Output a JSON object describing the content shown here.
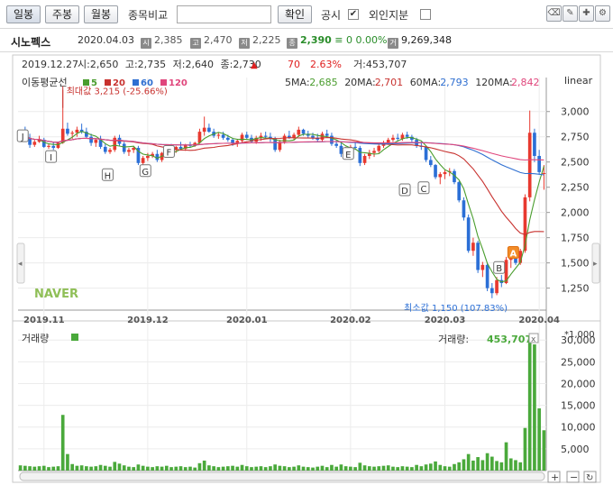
{
  "toolbar": {
    "daily": "일봉",
    "weekly": "주봉",
    "monthly": "월봉",
    "compare_label": "종목비교",
    "confirm": "확인",
    "disclosure_label": "공시",
    "foreign_label": "외인지분"
  },
  "header": {
    "name": "시노펙스",
    "date": "2020.04.03",
    "open": "2,385",
    "high": "2,470",
    "low": "2,225",
    "close": "2,390",
    "change_symbol": "≡",
    "change": "0",
    "change_pct": "0.00%",
    "volume": "9,269,348",
    "icons": [
      "시",
      "고",
      "저",
      "종",
      "거"
    ]
  },
  "chart_info": {
    "date": "2019.12.27",
    "open_label": "시:",
    "open": "2,650",
    "high_label": "고:",
    "high": "2,735",
    "low_label": "저:",
    "low": "2,640",
    "close_label": "종:",
    "close": "2,730",
    "change": "70",
    "change_pct": "2.63%",
    "vol_label": "거:",
    "volume": "453,707",
    "scale": "linear",
    "ma_title": "이동평균선",
    "ma_legend": [
      {
        "label": "5",
        "color": "#4a9d2e"
      },
      {
        "label": "20",
        "color": "#c8322f"
      },
      {
        "label": "60",
        "color": "#2f6fd1"
      },
      {
        "label": "120",
        "color": "#e0467c"
      }
    ],
    "ma_values": [
      {
        "label": "5MA:",
        "value": "2,685",
        "color": "#4a9d2e"
      },
      {
        "label": "20MA:",
        "value": "2,701",
        "color": "#c8322f"
      },
      {
        "label": "60MA:",
        "value": "2,793",
        "color": "#2f6fd1"
      },
      {
        "label": "120MA:",
        "value": "2,842",
        "color": "#e0467c"
      }
    ],
    "max_label": "최대값 3,215 (-25.66%)",
    "min_label": "최소값 1,150 (107.83%)",
    "watermark": "NAVER",
    "y_ticks": [
      3000,
      2750,
      2500,
      2250,
      2000,
      1750,
      1500,
      1250
    ],
    "y_tick_labels": [
      "3,000",
      "2,750",
      "2,500",
      "2,250",
      "2,000",
      "1,750",
      "1,500",
      "1,250"
    ],
    "x_labels": [
      "2019.11",
      "2019.12",
      "2020.01",
      "2020.02",
      "2020.03",
      "2020.04"
    ],
    "markers": [
      "J",
      "I",
      "H",
      "G",
      "F",
      "E",
      "D",
      "C",
      "B",
      "A"
    ],
    "vol_title": "거래량",
    "vol_value_label": "거래량:",
    "vol_value": "453,707",
    "vol_unit": "*1,000",
    "vol_ticks": [
      30000,
      25000,
      20000,
      15000,
      10000,
      5000
    ],
    "vol_tick_labels": [
      "30,000",
      "25,000",
      "20,000",
      "15,000",
      "10,000",
      "5,000"
    ]
  },
  "chart_data": {
    "type": "candlestick",
    "ylim": [
      1050,
      3230
    ],
    "volume_ylim": [
      0,
      31500
    ],
    "series": [
      {
        "name": "가격",
        "ohlc": [
          [
            2730,
            2810,
            2700,
            2790
          ],
          [
            2790,
            2850,
            2720,
            2740
          ],
          [
            2740,
            2780,
            2640,
            2670
          ],
          [
            2670,
            2720,
            2650,
            2700
          ],
          [
            2700,
            2760,
            2690,
            2720
          ],
          [
            2720,
            2740,
            2640,
            2650
          ],
          [
            2650,
            2680,
            2630,
            2660
          ],
          [
            2660,
            2700,
            2620,
            2640
          ],
          [
            2640,
            2700,
            2630,
            2690
          ],
          [
            2690,
            3215,
            2680,
            2830
          ],
          [
            2830,
            2890,
            2760,
            2780
          ],
          [
            2780,
            2810,
            2730,
            2790
          ],
          [
            2790,
            2850,
            2750,
            2820
          ],
          [
            2820,
            2880,
            2780,
            2800
          ],
          [
            2800,
            2840,
            2740,
            2750
          ],
          [
            2750,
            2780,
            2660,
            2690
          ],
          [
            2690,
            2730,
            2650,
            2720
          ],
          [
            2720,
            2760,
            2630,
            2650
          ],
          [
            2650,
            2680,
            2580,
            2600
          ],
          [
            2600,
            2640,
            2580,
            2620
          ],
          [
            2620,
            2760,
            2600,
            2740
          ],
          [
            2740,
            2770,
            2660,
            2680
          ],
          [
            2680,
            2700,
            2580,
            2600
          ],
          [
            2600,
            2640,
            2560,
            2620
          ],
          [
            2620,
            2660,
            2590,
            2640
          ],
          [
            2640,
            2660,
            2470,
            2490
          ],
          [
            2490,
            2560,
            2470,
            2540
          ],
          [
            2540,
            2590,
            2510,
            2560
          ],
          [
            2560,
            2600,
            2540,
            2580
          ],
          [
            2580,
            2620,
            2500,
            2520
          ],
          [
            2520,
            2600,
            2500,
            2590
          ],
          [
            2590,
            2660,
            2570,
            2640
          ],
          [
            2640,
            2680,
            2600,
            2620
          ],
          [
            2620,
            2660,
            2590,
            2650
          ],
          [
            2650,
            2700,
            2620,
            2630
          ],
          [
            2630,
            2680,
            2610,
            2670
          ],
          [
            2670,
            2700,
            2640,
            2660
          ],
          [
            2660,
            2700,
            2650,
            2690
          ],
          [
            2690,
            2830,
            2680,
            2800
          ],
          [
            2800,
            2950,
            2760,
            2840
          ],
          [
            2840,
            2880,
            2790,
            2800
          ],
          [
            2800,
            2830,
            2740,
            2760
          ],
          [
            2760,
            2790,
            2730,
            2770
          ],
          [
            2770,
            2800,
            2720,
            2740
          ],
          [
            2740,
            2770,
            2700,
            2720
          ],
          [
            2720,
            2740,
            2660,
            2680
          ],
          [
            2680,
            2730,
            2650,
            2710
          ],
          [
            2710,
            2790,
            2690,
            2770
          ],
          [
            2770,
            2800,
            2720,
            2740
          ],
          [
            2740,
            2770,
            2690,
            2700
          ],
          [
            2700,
            2760,
            2680,
            2740
          ],
          [
            2740,
            2790,
            2710,
            2760
          ],
          [
            2760,
            2800,
            2730,
            2750
          ],
          [
            2750,
            2790,
            2700,
            2730
          ],
          [
            2730,
            2750,
            2600,
            2620
          ],
          [
            2620,
            2720,
            2600,
            2700
          ],
          [
            2700,
            2780,
            2680,
            2760
          ],
          [
            2760,
            2810,
            2730,
            2740
          ],
          [
            2740,
            2790,
            2720,
            2770
          ],
          [
            2770,
            2850,
            2750,
            2820
          ],
          [
            2820,
            2830,
            2760,
            2780
          ],
          [
            2780,
            2810,
            2740,
            2760
          ],
          [
            2760,
            2790,
            2720,
            2740
          ],
          [
            2740,
            2780,
            2700,
            2720
          ],
          [
            2720,
            2800,
            2700,
            2780
          ],
          [
            2780,
            2820,
            2740,
            2760
          ],
          [
            2760,
            2790,
            2660,
            2680
          ],
          [
            2680,
            2720,
            2640,
            2660
          ],
          [
            2660,
            2700,
            2550,
            2580
          ],
          [
            2580,
            2650,
            2560,
            2620
          ],
          [
            2620,
            2670,
            2600,
            2650
          ],
          [
            2650,
            2700,
            2620,
            2640
          ],
          [
            2640,
            2660,
            2460,
            2490
          ],
          [
            2490,
            2580,
            2470,
            2560
          ],
          [
            2560,
            2620,
            2530,
            2590
          ],
          [
            2590,
            2640,
            2550,
            2610
          ],
          [
            2610,
            2680,
            2590,
            2660
          ],
          [
            2660,
            2710,
            2640,
            2690
          ],
          [
            2690,
            2740,
            2670,
            2720
          ],
          [
            2720,
            2770,
            2700,
            2740
          ],
          [
            2740,
            2780,
            2710,
            2730
          ],
          [
            2730,
            2790,
            2710,
            2770
          ],
          [
            2770,
            2800,
            2730,
            2750
          ],
          [
            2750,
            2770,
            2700,
            2720
          ],
          [
            2720,
            2740,
            2640,
            2660
          ],
          [
            2660,
            2700,
            2620,
            2650
          ],
          [
            2650,
            2660,
            2500,
            2520
          ],
          [
            2520,
            2560,
            2450,
            2470
          ],
          [
            2470,
            2480,
            2330,
            2350
          ],
          [
            2350,
            2400,
            2280,
            2380
          ],
          [
            2380,
            2420,
            2330,
            2400
          ],
          [
            2400,
            2440,
            2360,
            2410
          ],
          [
            2410,
            2430,
            2280,
            2300
          ],
          [
            2300,
            2310,
            2100,
            2120
          ],
          [
            2120,
            2150,
            1920,
            1950
          ],
          [
            1950,
            1980,
            1600,
            1620
          ],
          [
            1620,
            1750,
            1570,
            1700
          ],
          [
            1700,
            1720,
            1400,
            1430
          ],
          [
            1430,
            1510,
            1360,
            1480
          ],
          [
            1480,
            1500,
            1220,
            1250
          ],
          [
            1250,
            1300,
            1150,
            1200
          ],
          [
            1200,
            1360,
            1180,
            1330
          ],
          [
            1330,
            1380,
            1260,
            1300
          ],
          [
            1300,
            1560,
            1290,
            1530
          ],
          [
            1530,
            1600,
            1450,
            1580
          ],
          [
            1580,
            1620,
            1480,
            1500
          ],
          [
            1500,
            1640,
            1480,
            1620
          ],
          [
            1620,
            2180,
            1600,
            2150
          ],
          [
            2150,
            3010,
            2110,
            2790
          ],
          [
            2790,
            2830,
            2500,
            2560
          ],
          [
            2560,
            2620,
            2380,
            2400
          ],
          [
            2385,
            2470,
            2225,
            2390
          ]
        ]
      },
      {
        "name": "volume",
        "values": [
          1200,
          1100,
          1000,
          900,
          1000,
          1100,
          800,
          900,
          1000,
          12800,
          3800,
          1500,
          1100,
          1200,
          1000,
          900,
          1000,
          1300,
          1100,
          900,
          2000,
          1600,
          1200,
          900,
          800,
          1400,
          1100,
          900,
          800,
          1000,
          900,
          1100,
          800,
          900,
          1000,
          800,
          900,
          700,
          1700,
          2300,
          1200,
          1000,
          800,
          900,
          1000,
          1100,
          900,
          1300,
          1000,
          800,
          900,
          1000,
          800,
          1000,
          1400,
          1100,
          1000,
          800,
          900,
          1200,
          900,
          800,
          700,
          900,
          1100,
          800,
          1300,
          900,
          1400,
          1000,
          900,
          800,
          1800,
          1200,
          1000,
          900,
          1000,
          1100,
          1200,
          900,
          800,
          1000,
          900,
          800,
          1300,
          1000,
          1400,
          1600,
          2100,
          1300,
          1000,
          900,
          1500,
          1900,
          2600,
          3800,
          2300,
          3100,
          2400,
          4000,
          3200,
          2200,
          1900,
          6500,
          2800,
          2400,
          1900,
          9800,
          31000,
          29000,
          14300,
          9269
        ]
      }
    ]
  }
}
